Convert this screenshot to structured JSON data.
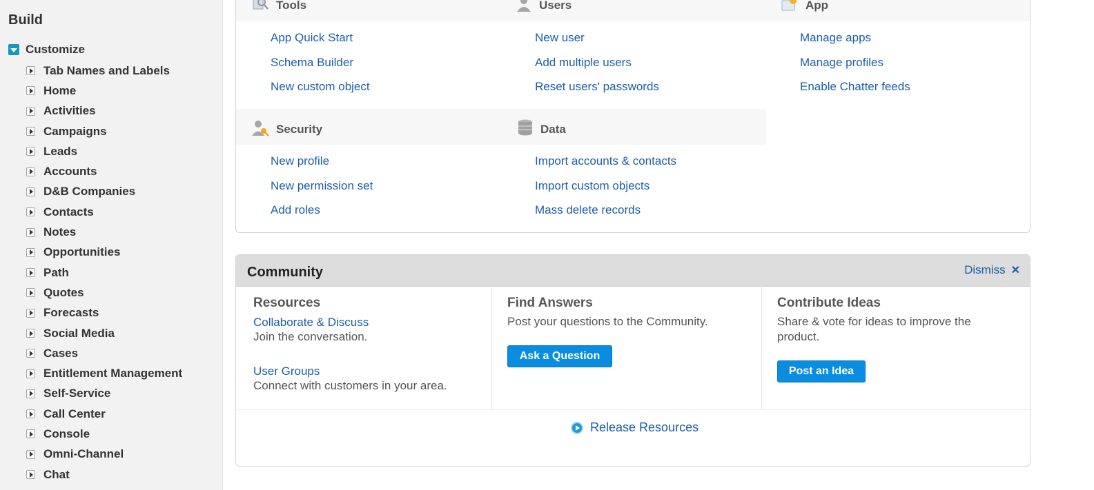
{
  "sidebar": {
    "heading": "Build",
    "customize_label": "Customize",
    "items": [
      "Tab Names and Labels",
      "Home",
      "Activities",
      "Campaigns",
      "Leads",
      "Accounts",
      "D&B Companies",
      "Contacts",
      "Notes",
      "Opportunities",
      "Path",
      "Quotes",
      "Forecasts",
      "Social Media",
      "Cases",
      "Entitlement Management",
      "Self-Service",
      "Call Center",
      "Console",
      "Omni-Channel",
      "Chat"
    ]
  },
  "quick_links": {
    "tools": {
      "title": "Tools",
      "links": [
        "App Quick Start",
        "Schema Builder",
        "New custom object"
      ]
    },
    "users": {
      "title": "Users",
      "links": [
        "New user",
        "Add multiple users",
        "Reset users' passwords"
      ]
    },
    "app": {
      "title": "App",
      "links": [
        "Manage apps",
        "Manage profiles",
        "Enable Chatter feeds"
      ]
    },
    "security": {
      "title": "Security",
      "links": [
        "New profile",
        "New permission set",
        "Add roles"
      ]
    },
    "data": {
      "title": "Data",
      "links": [
        "Import accounts & contacts",
        "Import custom objects",
        "Mass delete records"
      ]
    }
  },
  "community": {
    "title": "Community",
    "dismiss_label": "Dismiss",
    "resources": {
      "title": "Resources",
      "link1": "Collaborate & Discuss",
      "text1": "Join the conversation.",
      "link2": "User Groups",
      "text2": "Connect with customers in your area."
    },
    "find_answers": {
      "title": "Find Answers",
      "text": "Post your questions to the Community.",
      "button": "Ask a Question"
    },
    "contribute": {
      "title": "Contribute Ideas",
      "text": "Share & vote for ideas to improve the product.",
      "button": "Post an Idea"
    },
    "release_label": "Release Resources"
  }
}
